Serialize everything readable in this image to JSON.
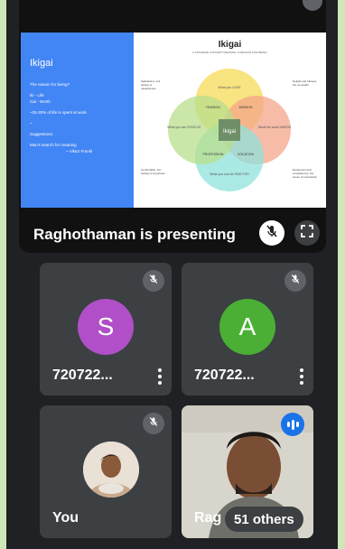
{
  "presentation": {
    "presenting_label": "Raghothaman is presenting",
    "slide": {
      "left_title": "Ikigai",
      "left_lines": [
        "The reason for being?",
        "Iki - Life",
        "Gai - Worth",
        "~25-30% of life is spent at work.",
        "~",
        "Suggestions:",
        "Man's search for meaning",
        "~ Viktor Frankl"
      ],
      "diagram_title": "Ikigai",
      "diagram_subtitle": "A JAPANESE CONCEPT MEANING 'A REASON FOR BEING'",
      "circles": [
        "What you LOVE",
        "What the world NEEDS",
        "What you can be PAID FOR",
        "What you are GOOD AT"
      ],
      "overlaps": [
        "PASSION",
        "MISSION",
        "PROFESSION",
        "VOCATION"
      ],
      "center": "Ikigai",
      "notes": [
        "Satisfaction, but feeling of uselessness",
        "Delight and fullness, but no wealth",
        "Comfortable, but feeling of emptiness",
        "Excitement and complacency, but sense of uncertainty"
      ]
    }
  },
  "participants": [
    {
      "initial": "S",
      "name": "720722...",
      "color": "#b04fc7",
      "muted": true
    },
    {
      "initial": "A",
      "name": "720722...",
      "color": "#4caf35",
      "muted": true
    },
    {
      "name": "You",
      "muted": true
    }
  ],
  "video_tile": {
    "name": "Rag",
    "others_label": "51 others"
  },
  "icons": [
    "mic-off-icon",
    "fullscreen-icon",
    "more-vert-icon",
    "speaking-indicator-icon"
  ]
}
